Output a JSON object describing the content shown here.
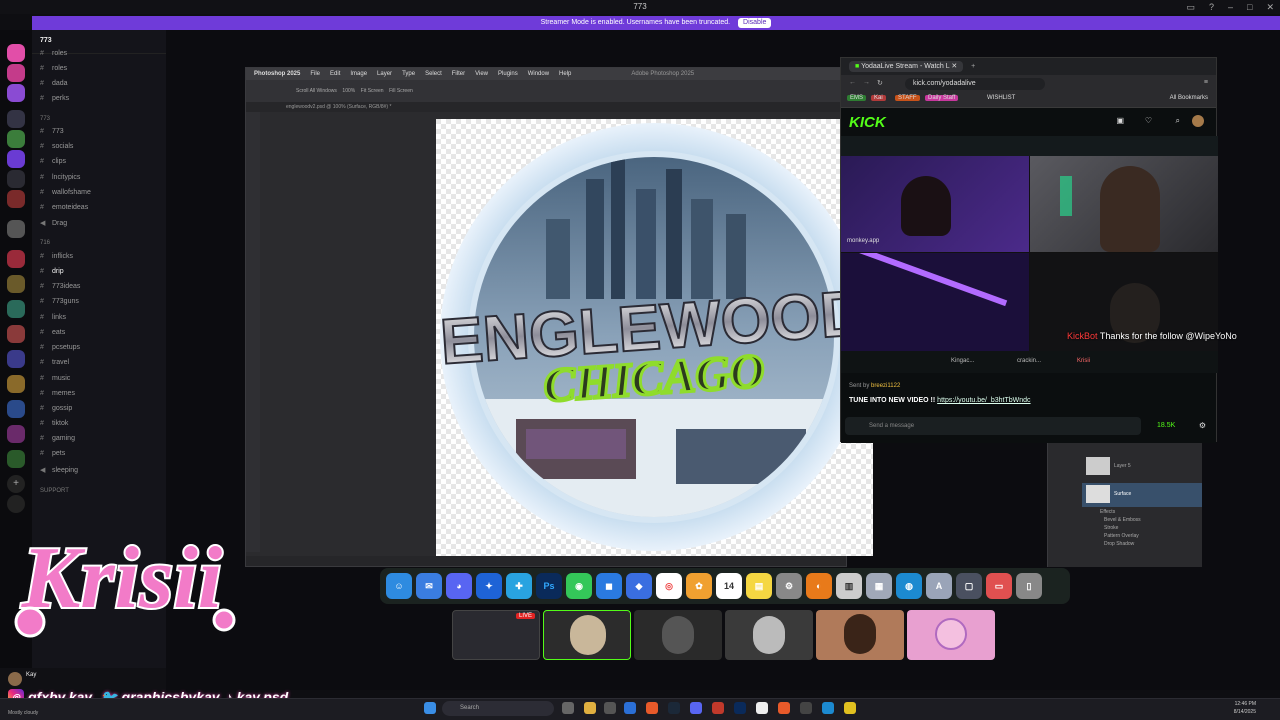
{
  "window_title": "773",
  "streamer_mode": {
    "message": "Streamer Mode is enabled. Usernames have been truncated.",
    "button": "Disable"
  },
  "server": {
    "name": "773",
    "channels_top": [
      "roles",
      "roles",
      "dada",
      "perks"
    ],
    "category_773": "773",
    "channels_773": [
      "773",
      "socials",
      "clips",
      "lncitypics",
      "wallofshame",
      "emoteideas",
      "Drag"
    ],
    "category_716": "716",
    "channels_716": [
      "inflicks",
      "drip",
      "773ideas",
      "773guns",
      "links",
      "eats",
      "pcsetups",
      "travel",
      "music",
      "memes",
      "gossip",
      "tiktok",
      "gaming",
      "pets",
      "sleeping"
    ],
    "category_support": "SUPPORT"
  },
  "photoshop": {
    "app": "Photoshop 2025",
    "menu": [
      "File",
      "Edit",
      "Image",
      "Layer",
      "Type",
      "Select",
      "Filter",
      "View",
      "Plugins",
      "Window",
      "Help"
    ],
    "title": "Adobe Photoshop 2025",
    "options": [
      "Scroll All Windows",
      "100%",
      "Fit Screen",
      "Fill Screen"
    ],
    "doc_tab": "englewoodv2.psd @ 100% (Surface, RGB/8#) *",
    "artwork_line1": "ENGLEWOOD",
    "artwork_line2": "CHICAGO",
    "layers": [
      "Layer 5",
      "Surface",
      "Effects",
      "Bevel & Emboss",
      "Stroke",
      "Pattern Overlay",
      "Drop Shadow"
    ]
  },
  "browser": {
    "tab_title": "YodaaLive Stream - Watch L",
    "url": "kick.com/yodadalive",
    "bookmarks": [
      "EMS",
      "Kai",
      "STAFF",
      "Daily Staff",
      "WISHLIST",
      "All Bookmarks"
    ],
    "kick_logo": "KICK",
    "overlay_handle": "monkey.app",
    "chat_overlay_user": "KickBot",
    "chat_overlay_msg": "Thanks for the follow @WipeYoNo",
    "mini_names": [
      "Kingac...",
      "crackin...",
      "Krisii"
    ],
    "pinned_by": "Sent by",
    "pinned_user": "breezi1122",
    "pinned_msg": "TUNE INTO NEW VIDEO !!",
    "pinned_link": "https://youtu.be/_b3htTbWndc",
    "chat_placeholder": "Send a message",
    "viewers": "18.5K"
  },
  "thumbs": {
    "live_badge": "LIVE"
  },
  "overlay": {
    "logo_text": "Krisii",
    "socials": [
      "gfxby.kay",
      "graphicsbykay",
      "kay.psd"
    ]
  },
  "user": {
    "name": "Kay",
    "status": "Mostly cloudy"
  },
  "taskbar": {
    "search": "Search",
    "time": "12:46 PM",
    "date": "8/14/2025"
  }
}
